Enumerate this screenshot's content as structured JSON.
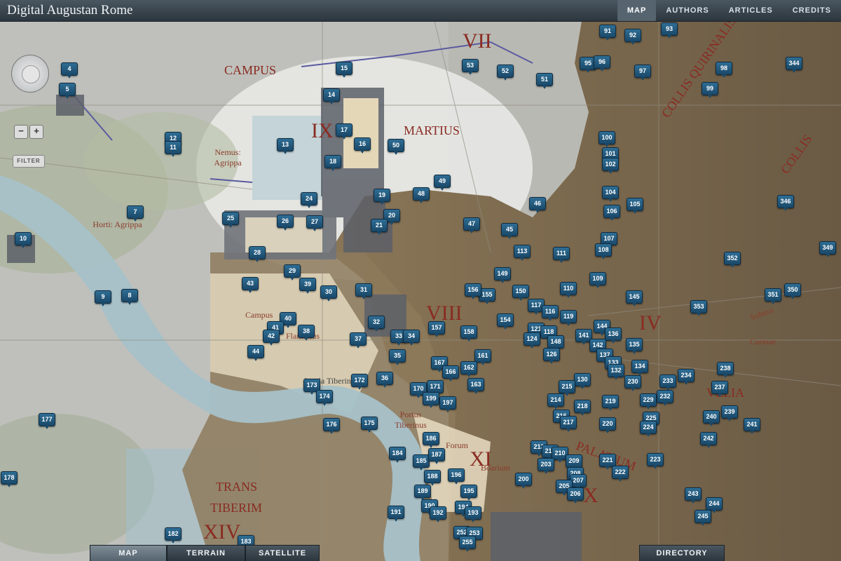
{
  "app": {
    "title": "Digital Augustan Rome"
  },
  "top_nav": [
    {
      "label": "MAP",
      "active": true
    },
    {
      "label": "AUTHORS",
      "active": false
    },
    {
      "label": "ARTICLES",
      "active": false
    },
    {
      "label": "CREDITS",
      "active": false
    }
  ],
  "controls": {
    "zoom_out": "−",
    "zoom_in": "+",
    "filter": "FILTER",
    "pan_icon": "pan-control-icon"
  },
  "bottom_tabs": [
    {
      "label": "MAP",
      "active": true
    },
    {
      "label": "TERRAIN",
      "active": false
    },
    {
      "label": "SATELLITE",
      "active": false
    },
    {
      "label": "DIRECTORY",
      "active": false
    }
  ],
  "regions": [
    "VII",
    "CAMPUS",
    "MARTIUS",
    "IX",
    "Nemus: Agrippa",
    "Horti: Agrippa",
    "VIII",
    "IV",
    "XI",
    "Forum",
    "Campus",
    "Flaminius",
    "Portus Tiberinus",
    "Insula Tiberina",
    "TRANS",
    "TIBERIM",
    "XIV",
    "X",
    "COLLIS QUIRINALIS",
    "COLLIS",
    "VELIA",
    "PALATIUM",
    "Boarium",
    "Carinae",
    "Subura"
  ],
  "markers": [
    "4",
    "5",
    "15",
    "53",
    "52",
    "51",
    "91",
    "92",
    "93",
    "95",
    "96",
    "97",
    "98",
    "99",
    "344",
    "14",
    "17",
    "16",
    "12",
    "11",
    "13",
    "18",
    "50",
    "100",
    "101",
    "102",
    "104",
    "105",
    "106",
    "346",
    "7",
    "24",
    "19",
    "48",
    "49",
    "46",
    "25",
    "26",
    "27",
    "20",
    "21",
    "47",
    "45",
    "107",
    "108",
    "10",
    "28",
    "111",
    "113",
    "29",
    "149",
    "109",
    "352",
    "349",
    "43",
    "39",
    "30",
    "31",
    "155",
    "156",
    "150",
    "110",
    "145",
    "351",
    "350",
    "9",
    "8",
    "117",
    "116",
    "119",
    "353",
    "40",
    "41",
    "42",
    "38",
    "32",
    "157",
    "158",
    "154",
    "121",
    "118",
    "144",
    "136",
    "37",
    "33",
    "34",
    "35",
    "161",
    "124",
    "148",
    "141",
    "142",
    "137",
    "44",
    "134",
    "135",
    "167",
    "166",
    "162",
    "126",
    "133",
    "132",
    "130",
    "173",
    "172",
    "36",
    "171",
    "170",
    "199",
    "163",
    "215",
    "230",
    "233",
    "234",
    "238",
    "174",
    "197",
    "214",
    "218",
    "219",
    "229",
    "232",
    "237",
    "177",
    "176",
    "175",
    "216",
    "217",
    "220",
    "225",
    "224",
    "239",
    "240",
    "241",
    "186",
    "213",
    "212",
    "210",
    "209",
    "242",
    "184",
    "185",
    "187",
    "221",
    "223",
    "178",
    "188",
    "196",
    "203",
    "208",
    "222",
    "200",
    "207",
    "189",
    "195",
    "205",
    "206",
    "243",
    "244",
    "245",
    "191",
    "190",
    "192",
    "194",
    "193",
    "182",
    "183",
    "252",
    "253",
    "255"
  ]
}
